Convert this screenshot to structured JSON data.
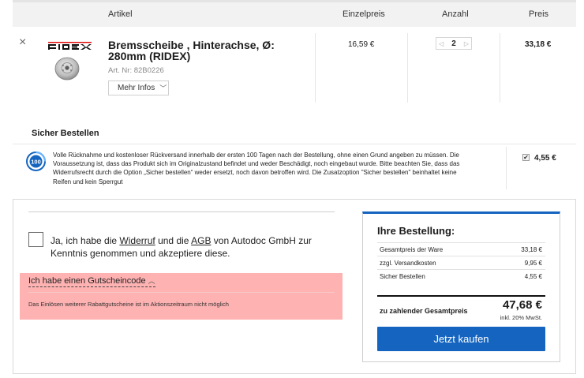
{
  "table": {
    "headers": {
      "article": "Artikel",
      "unit_price": "Einzelpreis",
      "quantity": "Anzahl",
      "price": "Preis"
    }
  },
  "item": {
    "brand": "RIDEX",
    "title": "Bremsscheibe , Hinterachse, Ø: 280mm (RIDEX)",
    "art_nr": "Art. Nr: 82B0226",
    "more_label": "Mehr Infos",
    "unit_price": "16,59 €",
    "quantity": "2",
    "line_total": "33,18 €"
  },
  "safe_order": {
    "title": "Sicher Bestellen",
    "badge": "100",
    "description": "Volle Rücknahme und kostenloser Rückversand innerhalb der ersten 100 Tagen nach der Bestellung, ohne einen Grund angeben zu müssen. Die Voraussetzung ist, dass das Produkt sich im Originalzustand befindet und weder Beschädigt, noch eingebaut wurde. Bitte beachten Sie, dass das Widerrufsrecht durch die Option „Sicher bestellen“ weder ersetzt, noch davon betroffen wird. Die Zusatzoption \"Sicher bestellen\" beinhaltet keine Reifen und kein Sperrgut",
    "checked": true,
    "price": "4,55 €"
  },
  "agreement": {
    "text_before": "Ja, ich habe die ",
    "widerruf": "Widerruf",
    "text_mid": " und die ",
    "agb": "AGB",
    "text_after": " von Autodoc GmbH zur Kenntnis genommen und akzeptiere diese."
  },
  "coupon": {
    "link": "Ich habe einen Gutscheincode",
    "note": "Das Einlösen weiterer Rabattgutscheine ist im Aktionszeitraum nicht möglich"
  },
  "summary": {
    "title": "Ihre Bestellung:",
    "rows": [
      {
        "label": "Gesamtpreis der Ware",
        "value": "33,18 €"
      },
      {
        "label": "zzgl. Versandkosten",
        "value": "9,95 €"
      },
      {
        "label": "Sicher Bestellen",
        "value": "4,55 €"
      }
    ],
    "total_label": "zu zahlender Gesamtpreis",
    "total_value": "47,68 €",
    "vat_note": "inkl. 20% MwSt.",
    "buy_label": "Jetzt kaufen"
  },
  "colors": {
    "primary": "#1565c0",
    "coupon_bg": "#ffb2b2"
  }
}
